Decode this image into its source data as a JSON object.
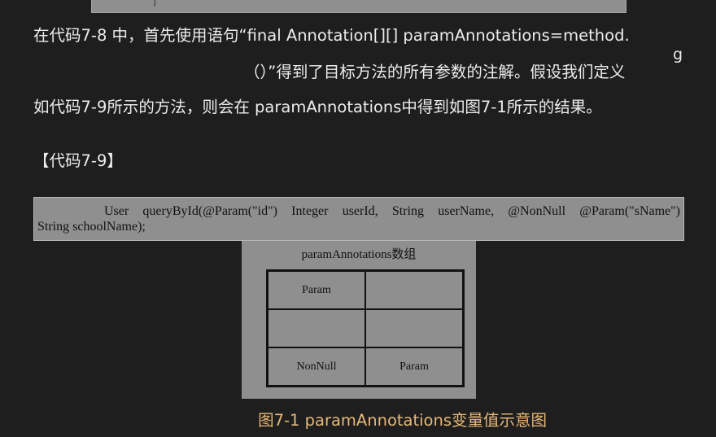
{
  "prev_code": {
    "closing_brace": "}"
  },
  "paragraph": {
    "line1": "在代码7-8 中，首先使用语句“final Annotation[][] paramAnnotations=method.",
    "stray_char": "g",
    "line2": "（）”得到了目标方法的所有参数的注解。假设我们定义",
    "line3": "如代码7-9所示的方法，则会在 paramAnnotations中得到如图7-1所示的结果。"
  },
  "heading": "【代码7-9】",
  "code": {
    "line1": "User queryById(@Param(\"id\") Integer userId, String userName, @NonNull @Param(\"sName\")",
    "line2": "String schoolName);"
  },
  "figure": {
    "title": "paramAnnotations数组",
    "cells": [
      [
        "Param",
        ""
      ],
      [
        "",
        ""
      ],
      [
        "NonNull",
        "Param"
      ]
    ],
    "caption": "图7-1 paramAnnotations变量值示意图"
  }
}
